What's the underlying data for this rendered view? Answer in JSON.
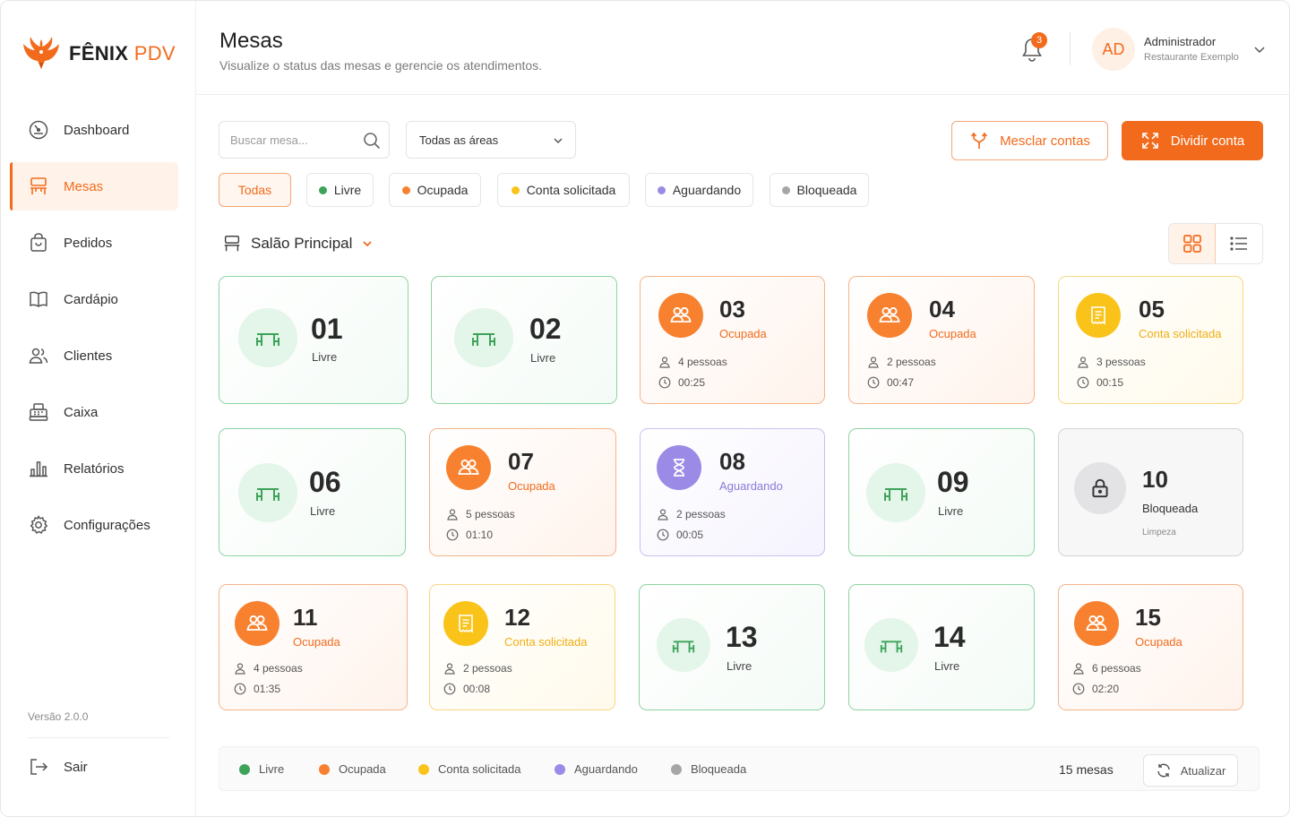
{
  "brand": {
    "name": "FÊNIX",
    "suffix": "PDV"
  },
  "sidebar": {
    "items": [
      {
        "label": "Dashboard",
        "icon": "dashboard-icon"
      },
      {
        "label": "Mesas",
        "icon": "table-chair-icon",
        "active": true
      },
      {
        "label": "Pedidos",
        "icon": "shopping-bag-icon"
      },
      {
        "label": "Cardápio",
        "icon": "book-icon"
      },
      {
        "label": "Clientes",
        "icon": "users-icon"
      },
      {
        "label": "Caixa",
        "icon": "cash-register-icon"
      },
      {
        "label": "Relatórios",
        "icon": "bar-chart-icon"
      },
      {
        "label": "Configurações",
        "icon": "gear-icon"
      }
    ],
    "version": "Versão 2.0.0",
    "logout": "Sair"
  },
  "header": {
    "title": "Mesas",
    "subtitle": "Visualize o status das mesas e gerencie os atendimentos.",
    "notifications": "3",
    "user": {
      "initials": "AD",
      "name": "Administrador",
      "org": "Restaurante Exemplo"
    }
  },
  "toolbar": {
    "search_placeholder": "Buscar mesa...",
    "area": "Todas as áreas",
    "merge": "Mesclar contas",
    "split": "Dividir conta"
  },
  "filters": {
    "all": "Todas",
    "livre": "Livre",
    "ocupada": "Ocupada",
    "conta": "Conta solicitada",
    "aguardando": "Aguardando",
    "bloqueada": "Bloqueada"
  },
  "section": {
    "name": "Salão Principal"
  },
  "colors": {
    "accent": "#f26b1d",
    "livre": "#3ea35a",
    "ocupada": "#f7812f",
    "conta": "#f9c31a",
    "aguardando": "#9b8ae6",
    "bloqueada": "#a6a6a6"
  },
  "tables": [
    {
      "number": "01",
      "status": "Livre"
    },
    {
      "number": "02",
      "status": "Livre"
    },
    {
      "number": "03",
      "status": "Ocupada",
      "people": "4 pessoas",
      "time": "00:25"
    },
    {
      "number": "04",
      "status": "Ocupada",
      "people": "2 pessoas",
      "time": "00:47"
    },
    {
      "number": "05",
      "status": "Conta solicitada",
      "people": "3 pessoas",
      "time": "00:15"
    },
    {
      "number": "06",
      "status": "Livre"
    },
    {
      "number": "07",
      "status": "Ocupada",
      "people": "5 pessoas",
      "time": "01:10"
    },
    {
      "number": "08",
      "status": "Aguardando",
      "people": "2 pessoas",
      "time": "00:05"
    },
    {
      "number": "09",
      "status": "Livre"
    },
    {
      "number": "10",
      "status": "Bloqueada",
      "note": "Limpeza"
    },
    {
      "number": "11",
      "status": "Ocupada",
      "people": "4 pessoas",
      "time": "01:35"
    },
    {
      "number": "12",
      "status": "Conta solicitada",
      "people": "2 pessoas",
      "time": "00:08"
    },
    {
      "number": "13",
      "status": "Livre"
    },
    {
      "number": "14",
      "status": "Livre"
    },
    {
      "number": "15",
      "status": "Ocupada",
      "people": "6 pessoas",
      "time": "02:20"
    }
  ],
  "legend": {
    "livre": "Livre",
    "ocupada": "Ocupada",
    "conta": "Conta solicitada",
    "aguardando": "Aguardando",
    "bloqueada": "Bloqueada",
    "count": "15 mesas",
    "refresh": "Atualizar"
  }
}
